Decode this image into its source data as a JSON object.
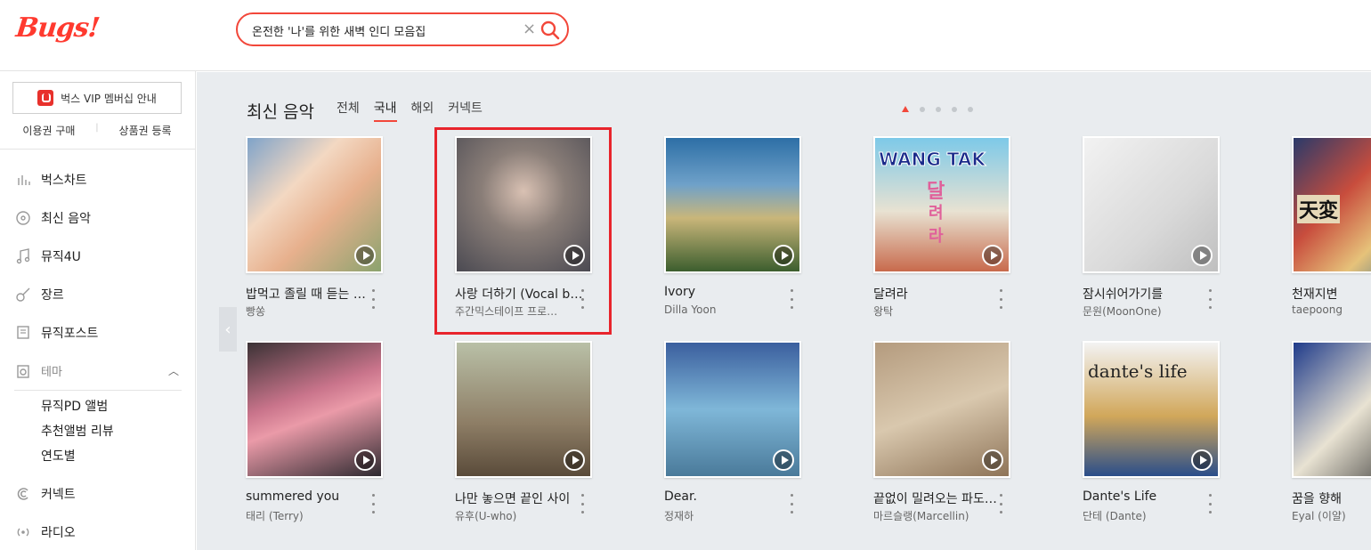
{
  "brand": {
    "logo_text": "Bugs!"
  },
  "search": {
    "value": "온전한 '나'를 위한 새벽 인디 모음집",
    "placeholder": ""
  },
  "sidebar": {
    "vip_label": "벅스 VIP 멤버십 안내",
    "links": [
      "이용권 구매",
      "상품권 등록"
    ],
    "nav": [
      {
        "label": "벅스차트",
        "icon": "chart-icon"
      },
      {
        "label": "최신 음악",
        "icon": "disc-icon"
      },
      {
        "label": "뮤직4U",
        "icon": "music-note-icon"
      },
      {
        "label": "장르",
        "icon": "guitar-icon"
      },
      {
        "label": "뮤직포스트",
        "icon": "post-icon"
      }
    ],
    "theme_label": "테마",
    "theme_items": [
      "뮤직PD 앨범",
      "추천앨범 리뷰",
      "연도별"
    ],
    "nav_bottom": [
      {
        "label": "커넥트",
        "icon": "connect-icon"
      },
      {
        "label": "라디오",
        "icon": "radio-icon"
      }
    ]
  },
  "main": {
    "section_title": "최신 음악",
    "tabs": [
      "전체",
      "국내",
      "해외",
      "커넥트"
    ],
    "active_tab": "국내",
    "albums": [
      {
        "title": "밥먹고 졸릴 때 듣는 노래",
        "artist": "빵쏭"
      },
      {
        "title": "사랑 더하기 (Vocal b…",
        "artist": "주간믹스테이프 프로…"
      },
      {
        "title": "Ivory",
        "artist": "Dilla Yoon"
      },
      {
        "title": "달려라",
        "artist": "왕탁"
      },
      {
        "title": "잠시쉬어가기를",
        "artist": "문원(MoonOne)"
      },
      {
        "title": "천재지변",
        "artist": "taepoong"
      },
      {
        "title": "summered you",
        "artist": "태리 (Terry)"
      },
      {
        "title": "나만 놓으면 끝인 사이",
        "artist": "유후(U-who)"
      },
      {
        "title": "Dear.",
        "artist": "정재하"
      },
      {
        "title": "끝없이 밀려오는 파도…",
        "artist": "마르슬랭(Marcellin)"
      },
      {
        "title": "Dante's Life",
        "artist": "단테 (Dante)"
      },
      {
        "title": "꿈을 향해",
        "artist": "Eyal (이얄)"
      }
    ],
    "cover_texts": {
      "wang_tak": "WANG TAK",
      "dal": "달",
      "ryeo": "려",
      "ra": "라",
      "dantes_life": "dante's life",
      "chunbyun": "天変"
    }
  },
  "colors": {
    "accent": "#f2473a",
    "highlight": "#e8242c",
    "main_bg": "#e9ecef"
  }
}
